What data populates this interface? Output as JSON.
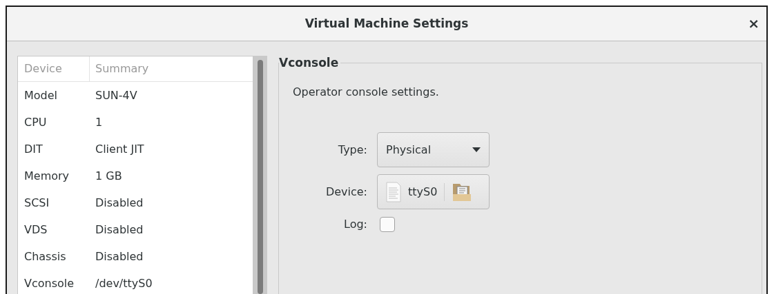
{
  "window": {
    "title": "Virtual Machine Settings",
    "close": "×"
  },
  "device_list": {
    "columns": [
      "Device",
      "Summary"
    ],
    "rows": [
      {
        "device": "Model",
        "summary": "SUN-4V"
      },
      {
        "device": "CPU",
        "summary": "1"
      },
      {
        "device": "DIT",
        "summary": "Client JIT"
      },
      {
        "device": "Memory",
        "summary": "1 GB"
      },
      {
        "device": "SCSI",
        "summary": "Disabled"
      },
      {
        "device": "VDS",
        "summary": "Disabled"
      },
      {
        "device": "Chassis",
        "summary": "Disabled"
      },
      {
        "device": "Vconsole",
        "summary": "/dev/ttyS0"
      }
    ]
  },
  "panel": {
    "title": "Vconsole",
    "description": "Operator console settings.",
    "fields": [
      {
        "kind": "dropdown",
        "label": "Type:",
        "value": "Physical"
      },
      {
        "kind": "file",
        "label": "Device:",
        "value": "ttyS0"
      },
      {
        "kind": "checkbox",
        "label": "Log:",
        "checked": false
      }
    ]
  }
}
